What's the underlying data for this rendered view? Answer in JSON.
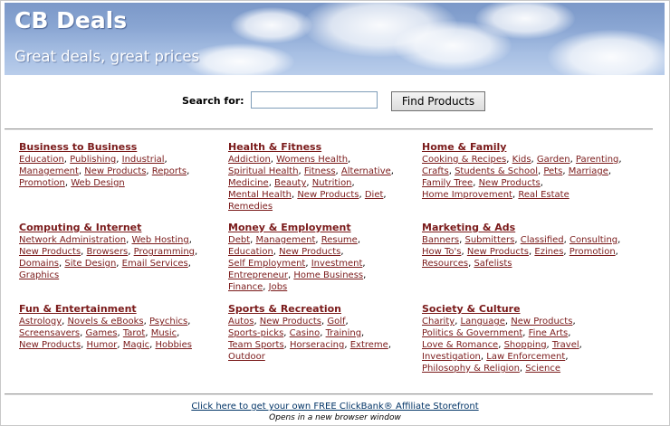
{
  "header": {
    "title": "CB Deals",
    "tagline": "Great deals, great prices"
  },
  "search": {
    "label": "Search for:",
    "value": "",
    "button_label": "Find Products"
  },
  "categories": [
    {
      "title": "Business to Business",
      "links": [
        "Education",
        "Publishing",
        "Industrial",
        "Management",
        "New Products",
        "Reports",
        "Promotion",
        "Web Design"
      ]
    },
    {
      "title": "Health & Fitness",
      "links": [
        "Addiction",
        "Womens Health",
        "Spiritual Health",
        "Fitness",
        "Alternative",
        "Medicine",
        "Beauty",
        "Nutrition",
        "Mental Health",
        "New Products",
        "Diet",
        "Remedies"
      ]
    },
    {
      "title": "Home & Family",
      "links": [
        "Cooking & Recipes",
        "Kids",
        "Garden",
        "Parenting",
        "Crafts",
        "Students & School",
        "Pets",
        "Marriage",
        "Family Tree",
        "New Products",
        "Home Improvement",
        "Real Estate"
      ]
    },
    {
      "title": "Computing & Internet",
      "links": [
        "Network Administration",
        "Web Hosting",
        "New Products",
        "Browsers",
        "Programming",
        "Domains",
        "Site Design",
        "Email Services",
        "Graphics"
      ]
    },
    {
      "title": "Money & Employment",
      "links": [
        "Debt",
        "Management",
        "Resume",
        "Education",
        "New Products",
        "Self Employment",
        "Investment",
        "Entrepreneur",
        "Home Business",
        "Finance",
        "Jobs"
      ]
    },
    {
      "title": "Marketing & Ads",
      "links": [
        "Banners",
        "Submitters",
        "Classified",
        "Consulting",
        "How To's",
        "New Products",
        "Ezines",
        "Promotion",
        "Resources",
        "Safelists"
      ]
    },
    {
      "title": "Fun & Entertainment",
      "links": [
        "Astrology",
        "Novels & eBooks",
        "Psychics",
        "Screensavers",
        "Games",
        "Tarot",
        "Music",
        "New Products",
        "Humor",
        "Magic",
        "Hobbies"
      ]
    },
    {
      "title": "Sports & Recreation",
      "links": [
        "Autos",
        "New Products",
        "Golf",
        "Sports-picks",
        "Casino",
        "Training",
        "Team Sports",
        "Horseracing",
        "Extreme",
        "Outdoor"
      ]
    },
    {
      "title": "Society & Culture",
      "links": [
        "Charity",
        "Language",
        "New Products",
        "Politics & Government",
        "Fine Arts",
        "Love & Romance",
        "Shopping",
        "Travel",
        "Investigation",
        "Law Enforcement",
        "Philosophy & Religion",
        "Science"
      ]
    }
  ],
  "footer": {
    "link_text": "Click here to get your own FREE ClickBank® Affiliate Storefront",
    "note": "Opens in a new browser window"
  },
  "colors": {
    "heading": "#003366",
    "link": "#7a1a1a",
    "banner_sky": "#8aa6d3"
  }
}
